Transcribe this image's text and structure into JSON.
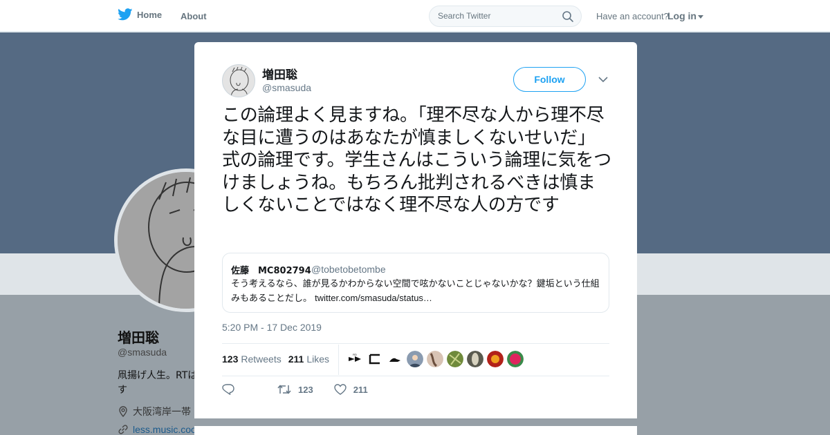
{
  "nav": {
    "home_label": "Home",
    "about_label": "About",
    "search_placeholder": "Search Twitter",
    "have_account": "Have an account?",
    "login_label": "Log in"
  },
  "background_profile": {
    "name": "増田聡",
    "handle": "@smasuda",
    "bio_line1": "凧揚げ人生。RTは",
    "bio_line2": "す",
    "location": "大阪湾岸一帯",
    "link": "less.music.coo"
  },
  "tweet": {
    "author_name": "増田聡",
    "author_handle": "@smasuda",
    "follow_label": "Follow",
    "text": "この論理よく見ますね。「理不尽な人から理不尽な目に遭うのはあなたが慎ましくないせいだ」式の論理です。学生さんはこういう論理に気をつけましょうね。もちろん批判されるべきは慎ましくないことではなく理不尽な人の方です",
    "quoted": {
      "name": "佐藤　MC802794",
      "handle": "@tobetobetombe",
      "text": "そう考えるなら、誰が見るかわからない空間で呟かないことじゃないかな？鍵垢という仕組みもあることだし。",
      "link": "twitter.com/smasuda/status…"
    },
    "timestamp": "5:20 PM - 17 Dec 2019",
    "retweets_count": "123",
    "retweets_label": "Retweets",
    "likes_count": "211",
    "likes_label": "Likes",
    "action_retweet_count": "123",
    "action_like_count": "211"
  },
  "colors": {
    "twitter_blue": "#1da1f2",
    "banner": "#556a83",
    "secondary_text": "#657786"
  }
}
